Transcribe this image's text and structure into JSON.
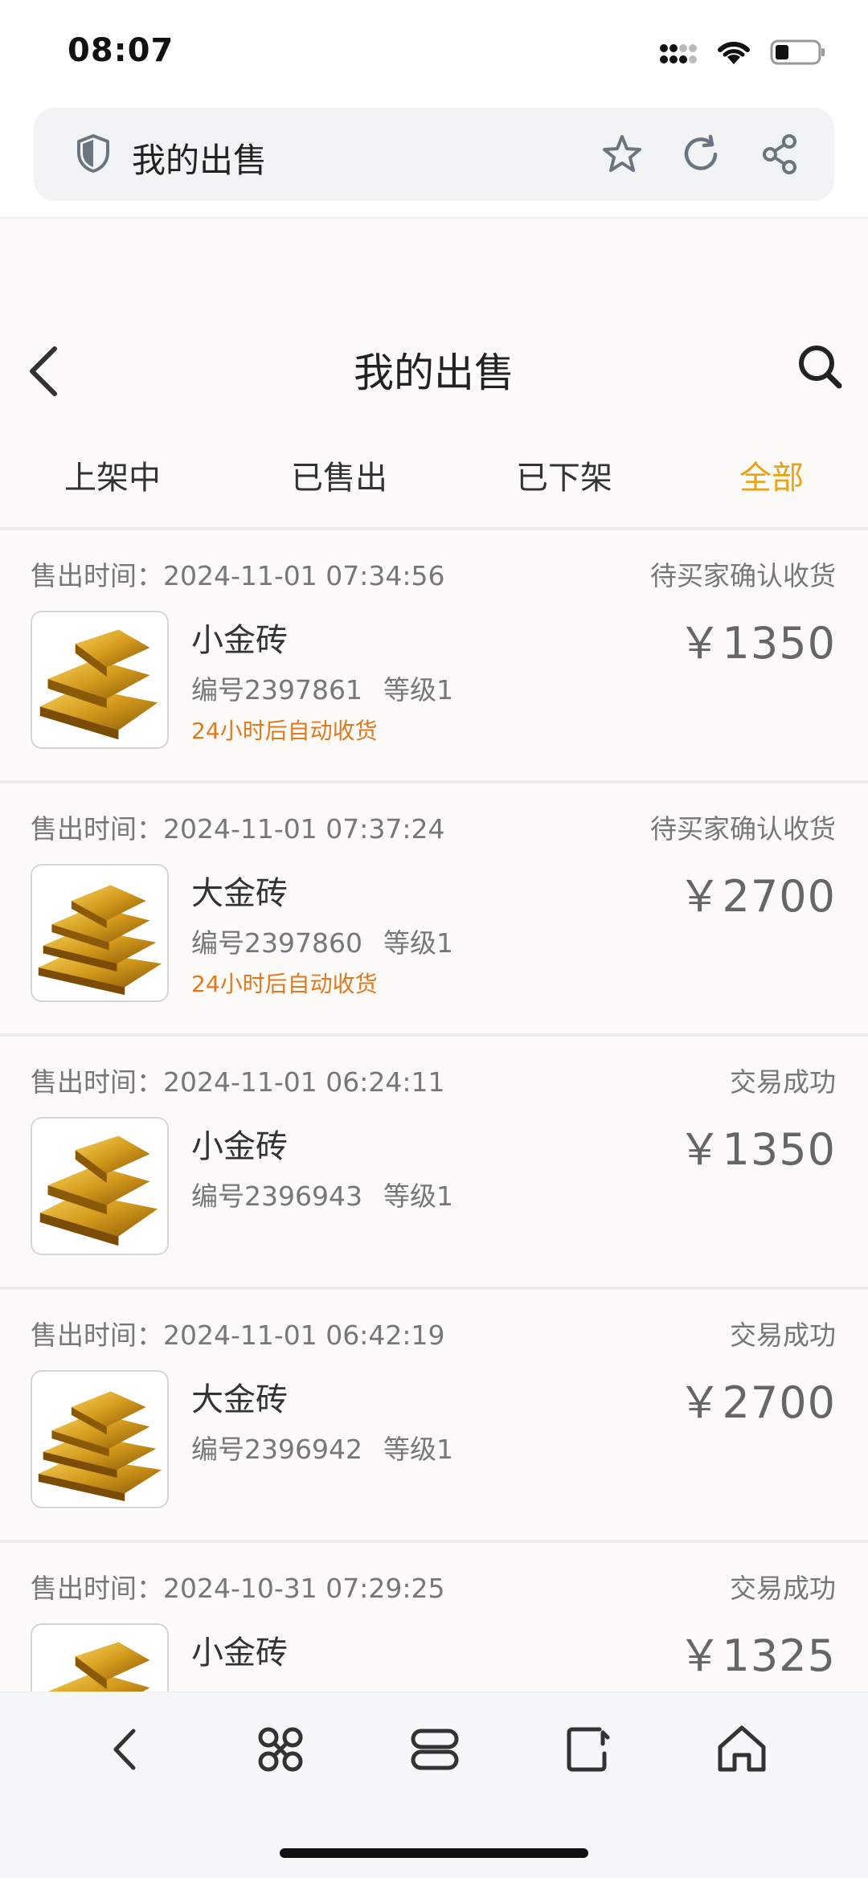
{
  "status_bar": {
    "time": "08:07"
  },
  "browser": {
    "title": "我的出售"
  },
  "header": {
    "title": "我的出售"
  },
  "tabs": [
    {
      "label": "上架中",
      "active": false
    },
    {
      "label": "已售出",
      "active": false
    },
    {
      "label": "已下架",
      "active": false
    },
    {
      "label": "全部",
      "active": true
    }
  ],
  "orders": [
    {
      "time": "售出时间：2024-11-01 07:34:56",
      "status": "待买家确认收货",
      "name": "小金砖",
      "id": "编号2397861",
      "level": "等级1",
      "note": "24小时后自动收货",
      "price": "￥1350",
      "icon": "small-gold-bar"
    },
    {
      "time": "售出时间：2024-11-01 07:37:24",
      "status": "待买家确认收货",
      "name": "大金砖",
      "id": "编号2397860",
      "level": "等级1",
      "note": "24小时后自动收货",
      "price": "￥2700",
      "icon": "large-gold-bar"
    },
    {
      "time": "售出时间：2024-11-01 06:24:11",
      "status": "交易成功",
      "name": "小金砖",
      "id": "编号2396943",
      "level": "等级1",
      "note": "",
      "price": "￥1350",
      "icon": "small-gold-bar"
    },
    {
      "time": "售出时间：2024-11-01 06:42:19",
      "status": "交易成功",
      "name": "大金砖",
      "id": "编号2396942",
      "level": "等级1",
      "note": "",
      "price": "￥2700",
      "icon": "large-gold-bar"
    },
    {
      "time": "售出时间：2024-10-31 07:29:25",
      "status": "交易成功",
      "name": "小金砖",
      "id": "",
      "level": "",
      "note": "",
      "price": "￥1325",
      "icon": "small-gold-bar"
    }
  ],
  "colors": {
    "accent": "#e8a317",
    "note": "#e07a1e"
  }
}
